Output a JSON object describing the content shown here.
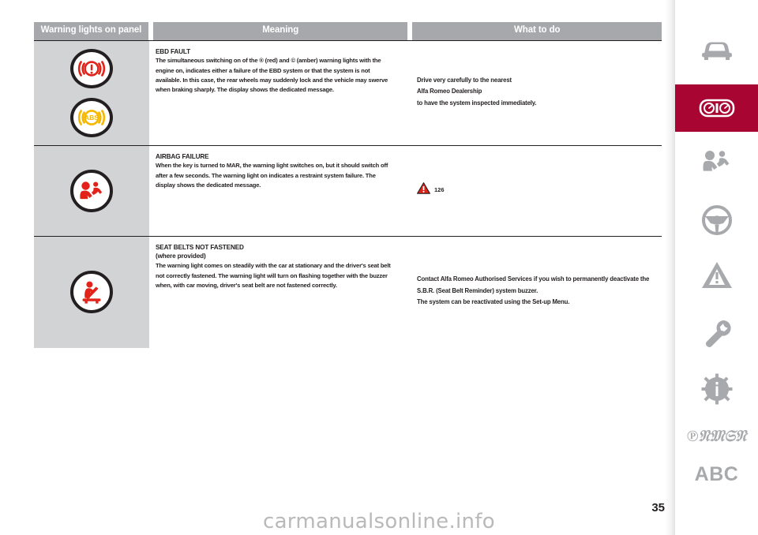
{
  "document": {
    "page_number": "35",
    "watermark": "carmanualsonline.info"
  },
  "table": {
    "headers": {
      "warning_lights": "Warning lights on panel",
      "meaning": "Meaning",
      "what_to_do": "What to do"
    },
    "rows": [
      {
        "icons": [
          "brake-fault-icon",
          "abs-icon"
        ],
        "title": "EBD FAULT",
        "meaning": "The simultaneous switching on of the ® (red) and © (amber) warning lights with the engine on, indicates either a failure of the EBD system or that the system is not available. In this case, the rear wheels may suddenly lock and the vehicle may swerve when braking sharply. The display shows the dedicated message.",
        "what_to_do": [
          "Drive very carefully to the nearest",
          "Alfa Romeo Dealership",
          "to have the system inspected immediately."
        ],
        "what_to_do_ref": null
      },
      {
        "icons": [
          "airbag-icon"
        ],
        "title": "AIRBAG FAILURE",
        "meaning": "When the key is turned to MAR, the warning light switches on, but it should switch off after a few seconds. The warning light on indicates a restraint system failure. The display shows the dedicated message.",
        "what_to_do": [],
        "what_to_do_ref": {
          "icon": "warning-triangle-icon",
          "label": "126"
        }
      },
      {
        "icons": [
          "seat-belt-icon"
        ],
        "title": "SEAT BELTS NOT FASTENED",
        "subtitle": "(where provided)",
        "meaning": "The warning light comes on steadily with the car at stationary and the driver's seat belt not correctly fastened. The warning light will turn on flashing together with the buzzer when, with car moving, driver's seat belt are not fastened correctly.",
        "what_to_do": [
          "Contact Alfa Romeo Authorised Services if you wish to permanently deactivate the S.B.R. (Seat Belt Reminder) system buzzer.",
          "The system can be reactivated using the Set-up Menu."
        ],
        "what_to_do_ref": null
      }
    ]
  },
  "sidebar": {
    "items": [
      {
        "name": "car-icon",
        "active": false
      },
      {
        "name": "dashboard-gauges-icon",
        "active": true
      },
      {
        "name": "safety-airbag-icon",
        "active": false
      },
      {
        "name": "steering-wheel-icon",
        "active": false
      },
      {
        "name": "warning-triangle-icon",
        "active": false
      },
      {
        "name": "wrench-icon",
        "active": false
      },
      {
        "name": "info-gear-icon",
        "active": false
      },
      {
        "name": "index-signature-icon",
        "active": false
      },
      {
        "name": "alphabetical-index-label",
        "active": false,
        "label": "ABC"
      }
    ]
  },
  "colors": {
    "header_gray": "#a6a8ab",
    "cell_gray": "#d2d3d5",
    "accent_crimson": "#a90533",
    "warn_red": "#e2231a",
    "warn_amber": "#f5b800",
    "text_dark": "#231f20",
    "sidebar_gray": "#a7a9ac"
  }
}
